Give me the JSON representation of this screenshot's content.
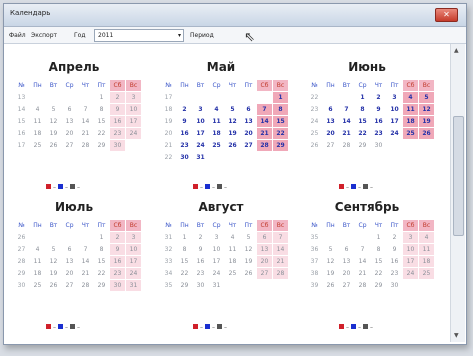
{
  "window": {
    "title": "Календарь",
    "close": "✕"
  },
  "menu": {
    "file": "Файл",
    "export": "Экспорт",
    "year_label": "Год",
    "year_value": "2011",
    "period": "Период"
  },
  "headers": [
    "№ нед.",
    "Пн",
    "Вт",
    "Ср",
    "Чт",
    "Пт",
    "Сб",
    "Вс"
  ],
  "colors": {
    "red": "#d0202a",
    "blue": "#1a2fd0",
    "gray": "#555555"
  },
  "legend": [
    "–",
    "–",
    "–"
  ],
  "months": [
    {
      "name": "Апрель",
      "weeks": [
        [
          "13",
          "",
          "",
          "",
          "",
          "1",
          "2",
          "3"
        ],
        [
          "14",
          "4",
          "5",
          "6",
          "7",
          "8",
          "9",
          "10"
        ],
        [
          "15",
          "11",
          "12",
          "13",
          "14",
          "15",
          "16",
          "17"
        ],
        [
          "16",
          "18",
          "19",
          "20",
          "21",
          "22",
          "23",
          "24"
        ],
        [
          "17",
          "25",
          "26",
          "27",
          "28",
          "29",
          "30",
          ""
        ]
      ]
    },
    {
      "name": "Май",
      "weeks": [
        [
          "17",
          "",
          "",
          "",
          "",
          "",
          "",
          "1"
        ],
        [
          "18",
          "2",
          "3",
          "4",
          "5",
          "6",
          "7",
          "8"
        ],
        [
          "19",
          "9",
          "10",
          "11",
          "12",
          "13",
          "14",
          "15"
        ],
        [
          "20",
          "16",
          "17",
          "18",
          "19",
          "20",
          "21",
          "22"
        ],
        [
          "21",
          "23",
          "24",
          "25",
          "26",
          "27",
          "28",
          "29"
        ],
        [
          "22",
          "30",
          "31",
          "",
          "",
          "",
          "",
          ""
        ]
      ]
    },
    {
      "name": "Июнь",
      "weeks": [
        [
          "22",
          "",
          "",
          "1",
          "2",
          "3",
          "4",
          "5"
        ],
        [
          "23",
          "6",
          "7",
          "8",
          "9",
          "10",
          "11",
          "12"
        ],
        [
          "24",
          "13",
          "14",
          "15",
          "16",
          "17",
          "18",
          "19"
        ],
        [
          "25",
          "20",
          "21",
          "22",
          "23",
          "24",
          "25",
          "26"
        ],
        [
          "26",
          "27",
          "28",
          "29",
          "30",
          "",
          "",
          ""
        ]
      ]
    },
    {
      "name": "Июль",
      "weeks": [
        [
          "26",
          "",
          "",
          "",
          "",
          "1",
          "2",
          "3"
        ],
        [
          "27",
          "4",
          "5",
          "6",
          "7",
          "8",
          "9",
          "10"
        ],
        [
          "28",
          "11",
          "12",
          "13",
          "14",
          "15",
          "16",
          "17"
        ],
        [
          "29",
          "18",
          "19",
          "20",
          "21",
          "22",
          "23",
          "24"
        ],
        [
          "30",
          "25",
          "26",
          "27",
          "28",
          "29",
          "30",
          "31"
        ]
      ]
    },
    {
      "name": "Август",
      "weeks": [
        [
          "31",
          "1",
          "2",
          "3",
          "4",
          "5",
          "6",
          "7"
        ],
        [
          "32",
          "8",
          "9",
          "10",
          "11",
          "12",
          "13",
          "14"
        ],
        [
          "33",
          "15",
          "16",
          "17",
          "18",
          "19",
          "20",
          "21"
        ],
        [
          "34",
          "22",
          "23",
          "24",
          "25",
          "26",
          "27",
          "28"
        ],
        [
          "35",
          "29",
          "30",
          "31",
          "",
          "",
          "",
          ""
        ]
      ]
    },
    {
      "name": "Сентябрь",
      "weeks": [
        [
          "35",
          "",
          "",
          "",
          "1",
          "2",
          "3",
          "4"
        ],
        [
          "36",
          "5",
          "6",
          "7",
          "8",
          "9",
          "10",
          "11"
        ],
        [
          "37",
          "12",
          "13",
          "14",
          "15",
          "16",
          "17",
          "18"
        ],
        [
          "38",
          "19",
          "20",
          "21",
          "22",
          "23",
          "24",
          "25"
        ],
        [
          "39",
          "26",
          "27",
          "28",
          "29",
          "30",
          "",
          ""
        ]
      ]
    }
  ]
}
